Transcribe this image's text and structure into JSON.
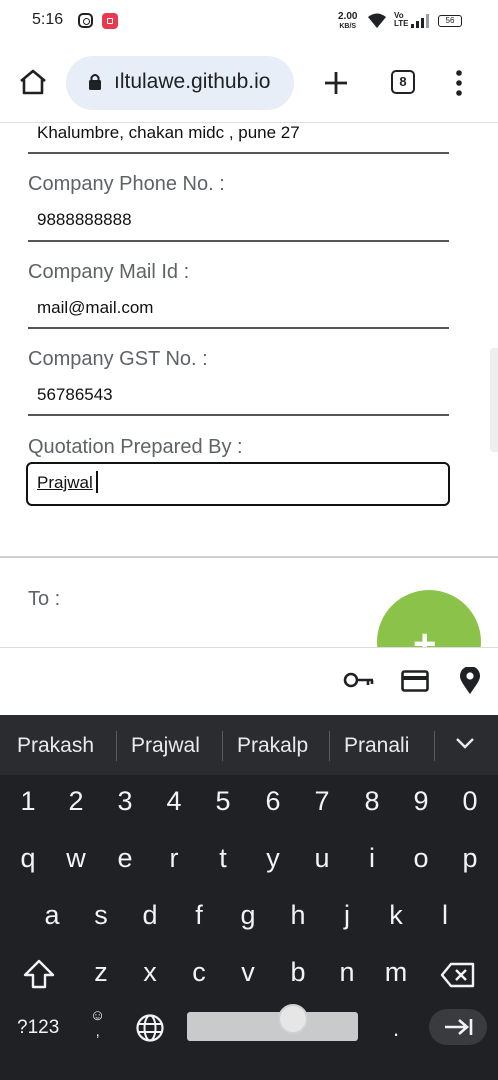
{
  "status_bar": {
    "time": "5:16",
    "net_speed": "2.00",
    "net_unit": "KB/S",
    "volte": "Vo LTE",
    "battery": "56"
  },
  "browser": {
    "url": "ıltulawe.github.io",
    "tab_count": "8"
  },
  "form": {
    "address_value": "Khalumbre, chakan midc , pune 27",
    "phone_label": "Company Phone No. :",
    "phone_value": "9888888888",
    "mail_label": "Company Mail Id :",
    "mail_value": "mail@mail.com",
    "gst_label": "Company GST No. :",
    "gst_value": "56786543",
    "prepared_label": "Quotation Prepared By :",
    "prepared_value": "Prajwal",
    "to_label": "To :",
    "fab_symbol": "+",
    "fab_color": "#8bc34a"
  },
  "keyboard": {
    "suggestions": [
      "Prakash",
      "Prajwal",
      "Prakalp",
      "Pranali"
    ],
    "row_numbers": [
      "1",
      "2",
      "3",
      "4",
      "5",
      "6",
      "7",
      "8",
      "9",
      "0"
    ],
    "row1": [
      "q",
      "w",
      "e",
      "r",
      "t",
      "y",
      "u",
      "i",
      "o",
      "p"
    ],
    "row2": [
      "a",
      "s",
      "d",
      "f",
      "g",
      "h",
      "j",
      "k",
      "l"
    ],
    "row3": [
      "z",
      "x",
      "c",
      "v",
      "b",
      "n",
      "m"
    ],
    "symbols_key": "?123",
    "emoji_key_top": "☺",
    "emoji_key_bottom": ",",
    "period_key": "."
  }
}
